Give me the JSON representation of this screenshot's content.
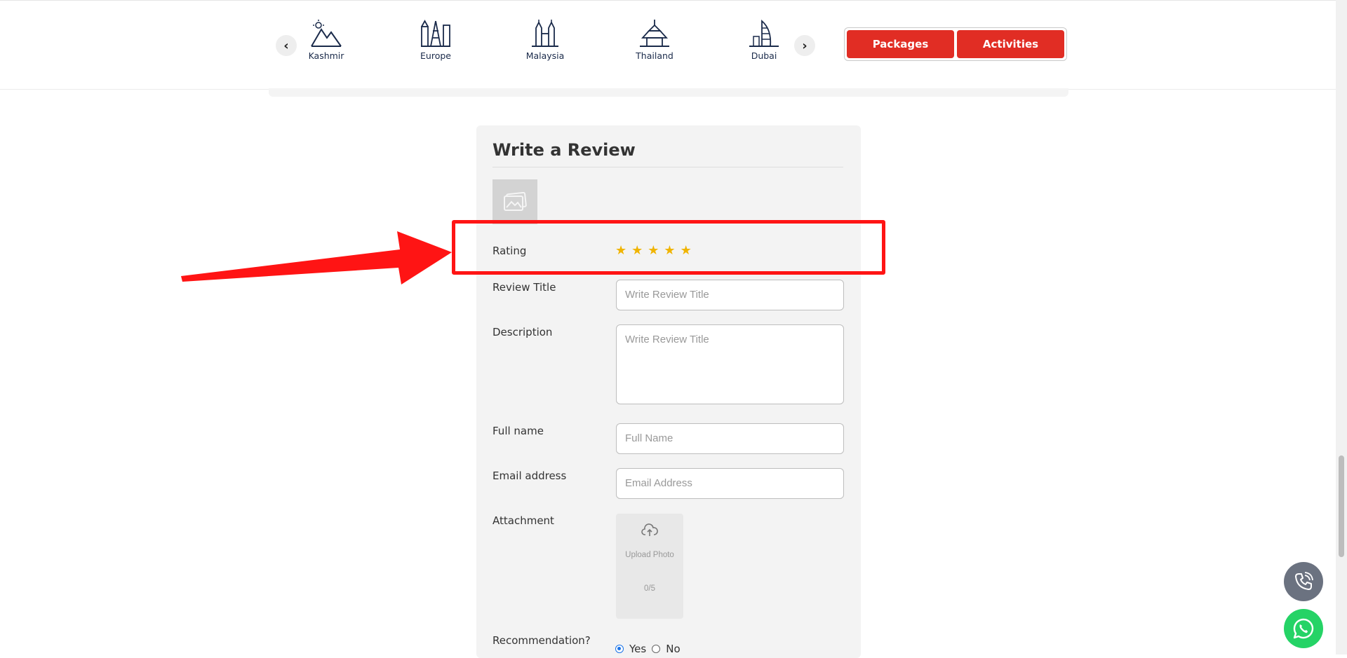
{
  "nav": {
    "prev_arrow": "‹",
    "next_arrow": "›",
    "destinations": [
      {
        "label": "Kashmir",
        "icon": "mountain-icon"
      },
      {
        "label": "Europe",
        "icon": "eiffel-tower-icon"
      },
      {
        "label": "Malaysia",
        "icon": "petronas-towers-icon"
      },
      {
        "label": "Thailand",
        "icon": "thai-temple-icon"
      },
      {
        "label": "Dubai",
        "icon": "burj-al-arab-icon"
      }
    ],
    "buttons": {
      "packages": "Packages",
      "activities": "Activities"
    }
  },
  "review": {
    "title": "Write a Review",
    "rating_label": "Rating",
    "rating_stars": 5,
    "review_title_label": "Review Title",
    "review_title_placeholder": "Write Review Title",
    "description_label": "Description",
    "description_placeholder": "Write Review Title",
    "full_name_label": "Full name",
    "full_name_placeholder": "Full Name",
    "email_label": "Email address",
    "email_placeholder": "Email Address",
    "attachment_label": "Attachment",
    "upload_text": "Upload Photo",
    "upload_count": "0/5",
    "recommendation_label": "Recommendation?",
    "yes_label": "Yes",
    "no_label": "No",
    "recommendation_value": "Yes"
  },
  "colors": {
    "accent_red": "#e12d24",
    "annotation_red": "#ff1414",
    "star": "#f0b400",
    "whatsapp": "#25d366"
  }
}
